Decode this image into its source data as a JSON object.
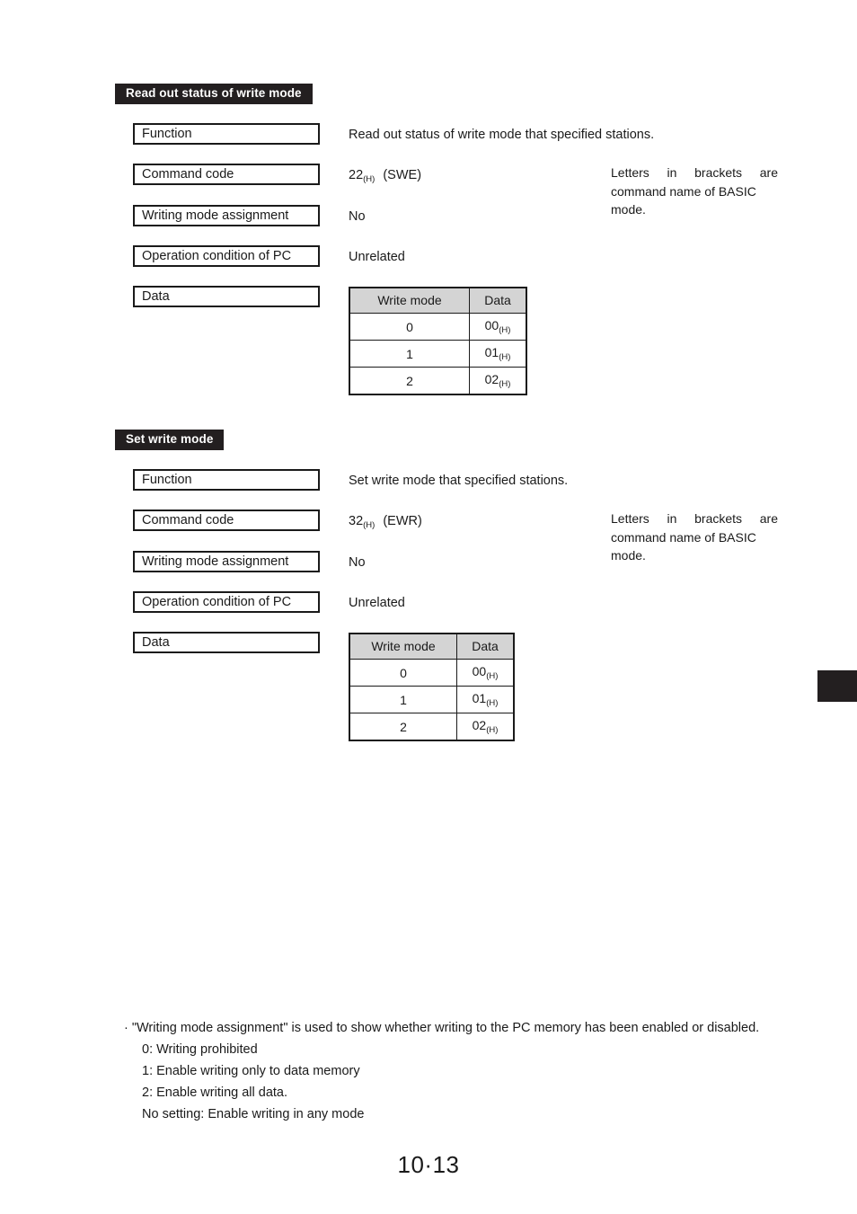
{
  "page": {
    "number": "10·13"
  },
  "sections": [
    {
      "banner": "Read out status of write mode",
      "rows": [
        {
          "label": "Function",
          "value": "Read out status of write mode that specified stations."
        },
        {
          "label": "Command code",
          "value_prefix": "22",
          "value_sub": "(H)",
          "value_suffix": "(SWE)"
        },
        {
          "label": "Writing mode assignment",
          "value": "No"
        },
        {
          "label": "Operation condition of PC",
          "value": "Unrelated"
        },
        {
          "label": "Data",
          "value": ""
        }
      ],
      "side_note": {
        "line1": "Letters in brackets are",
        "line2": "command name of BASIC",
        "line3": "mode."
      },
      "table": {
        "headers": [
          "Write mode",
          "Data"
        ],
        "rows": [
          {
            "mode": "0",
            "data": "00",
            "data_sub": "(H)"
          },
          {
            "mode": "1",
            "data": "01",
            "data_sub": "(H)"
          },
          {
            "mode": "2",
            "data": "02",
            "data_sub": "(H)"
          }
        ]
      }
    },
    {
      "banner": "Set write mode",
      "rows": [
        {
          "label": "Function",
          "value": "Set write mode that specified stations."
        },
        {
          "label": "Command code",
          "value_prefix": "32",
          "value_sub": "(H)",
          "value_suffix": "(EWR)"
        },
        {
          "label": "Writing mode assignment",
          "value": "No"
        },
        {
          "label": "Operation condition of PC",
          "value": "Unrelated"
        },
        {
          "label": "Data",
          "value": ""
        }
      ],
      "side_note": {
        "line1": "Letters in brackets are",
        "line2": "command name of BASIC",
        "line3": "mode."
      },
      "table": {
        "headers": [
          "Write mode",
          "Data"
        ],
        "rows": [
          {
            "mode": "0",
            "data": "00",
            "data_sub": "(H)"
          },
          {
            "mode": "1",
            "data": "01",
            "data_sub": "(H)"
          },
          {
            "mode": "2",
            "data": "02",
            "data_sub": "(H)"
          }
        ]
      }
    }
  ],
  "notes": {
    "bullet": "· \"Writing mode assignment\" is used to show whether writing to the PC memory has been enabled or disabled.",
    "items": [
      "0: Writing prohibited",
      "1: Enable writing only to data memory",
      "2: Enable writing all data.",
      "No setting: Enable writing in any mode"
    ]
  },
  "colors": {
    "banner_bg": "#231f20",
    "table_header_bg": "#d4d4d4",
    "ink": "#1a1a1a"
  }
}
